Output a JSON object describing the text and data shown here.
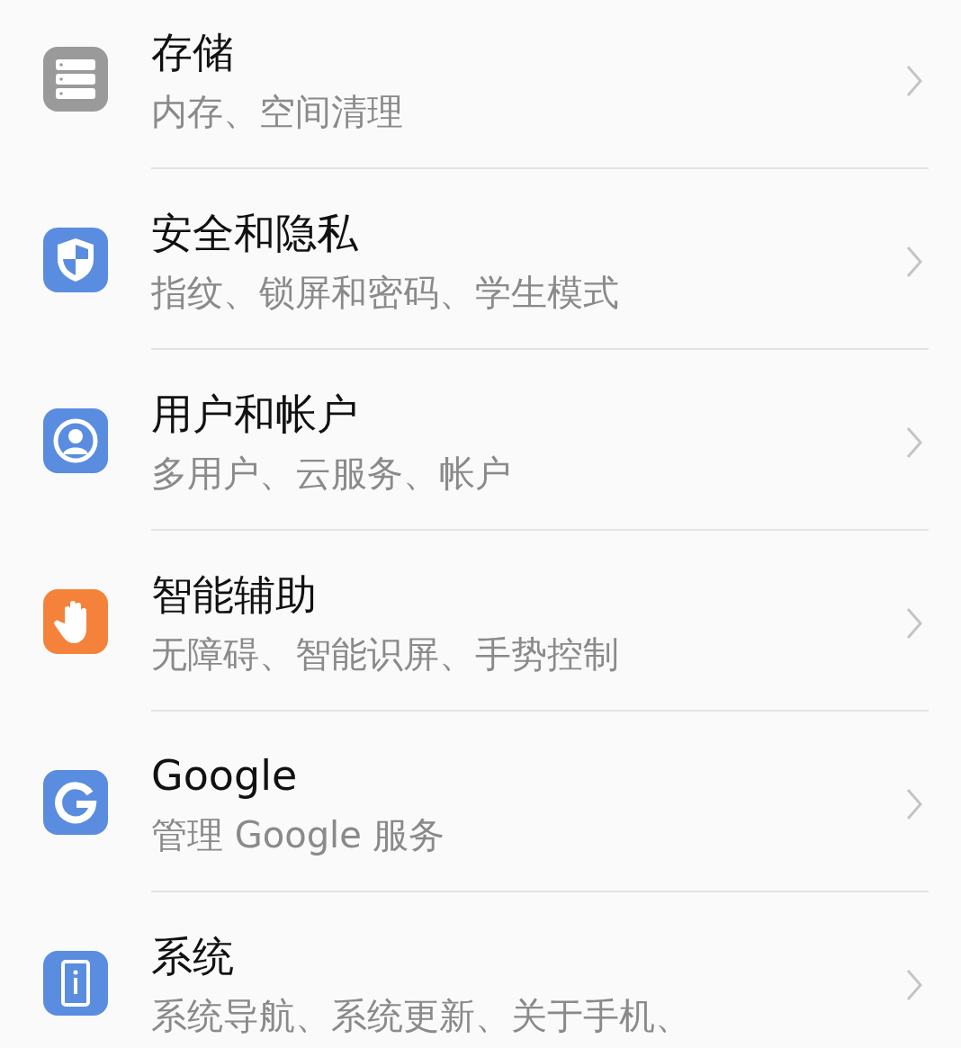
{
  "settings": [
    {
      "kind": "storage",
      "color": "#9a9a9a",
      "title": "存储",
      "subtitle": "内存、空间清理"
    },
    {
      "kind": "shield",
      "color": "#5a8de0",
      "title": "安全和隐私",
      "subtitle": "指纹、锁屏和密码、学生模式"
    },
    {
      "kind": "user",
      "color": "#5a8de0",
      "title": "用户和帐户",
      "subtitle": "多用户、云服务、帐户"
    },
    {
      "kind": "hand",
      "color": "#f5823a",
      "title": "智能辅助",
      "subtitle": "无障碍、智能识屏、手势控制"
    },
    {
      "kind": "google",
      "color": "#5a8de0",
      "title": "Google",
      "subtitle": "管理 Google 服务"
    },
    {
      "kind": "phone",
      "color": "#5a8de0",
      "title": "系统",
      "subtitle": "系统导航、系统更新、关于手机、"
    }
  ]
}
